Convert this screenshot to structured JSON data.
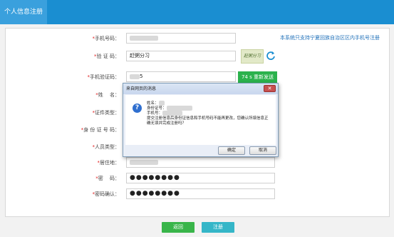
{
  "header": {
    "tab_label": "个人信息注册"
  },
  "form": {
    "phone": {
      "label": "手机号码：",
      "hint": "本系统只支持宁夏回族自治区区内手机号注册"
    },
    "captcha": {
      "label": "验 证 码：",
      "value": "赶粥分习",
      "image_text": "赶粥分习"
    },
    "sms_code": {
      "label": "手机验证码：",
      "value": "5",
      "button": "74 s 重新发送"
    },
    "name": {
      "label": "姓　 名："
    },
    "id_type": {
      "label": "证件类型："
    },
    "id_number": {
      "label": "身 份 证 号 码："
    },
    "person_type": {
      "label": "人员类型："
    },
    "residence": {
      "label": "居住地："
    },
    "password": {
      "label": "密　 码：",
      "value": "●●●●●●●●"
    },
    "password_confirm": {
      "label": "密码确认：",
      "value": "●●●●●●●●"
    }
  },
  "buttons": {
    "back": "返回",
    "register": "注册"
  },
  "dialog": {
    "title": "来自网页的消息",
    "close": "✕",
    "lines": [
      "姓名：",
      "身份证号：",
      "手机号：",
      "提交注册信息后身份证信息和手机号码不能再更改，您确认所填信息正",
      "确无误并完成注册吗？"
    ],
    "ok": "确定",
    "cancel": "取消"
  },
  "colors": {
    "header": "#1a8ed1",
    "tab": "#3aa0dd",
    "required": "#e02020",
    "sms_button": "#2bb24c",
    "back_button": "#39b54a",
    "register_button": "#35b6c8"
  }
}
